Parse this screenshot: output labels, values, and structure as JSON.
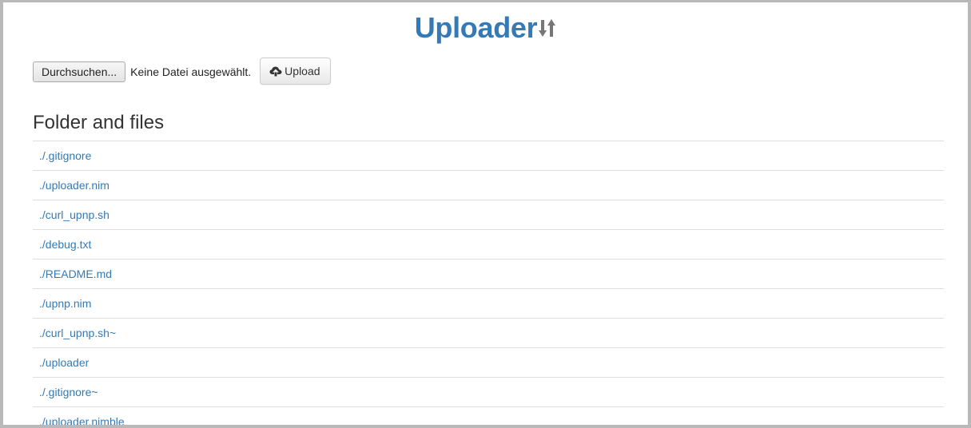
{
  "header": {
    "title": "Uploader"
  },
  "upload_form": {
    "browse_label": "Durchsuchen...",
    "no_file_text": "Keine Datei ausgewählt.",
    "upload_label": "Upload"
  },
  "files_section": {
    "heading": "Folder and files",
    "files": [
      "./.gitignore",
      "./uploader.nim",
      "./curl_upnp.sh",
      "./debug.txt",
      "./README.md",
      "./upnp.nim",
      "./curl_upnp.sh~",
      "./uploader",
      "./.gitignore~",
      "./uploader.nimble"
    ]
  },
  "icons": {
    "title_icon": "sort-arrows-icon",
    "upload_icon": "cloud-upload-icon"
  },
  "colors": {
    "accent": "#337ab7",
    "title_icon": "#777777"
  }
}
